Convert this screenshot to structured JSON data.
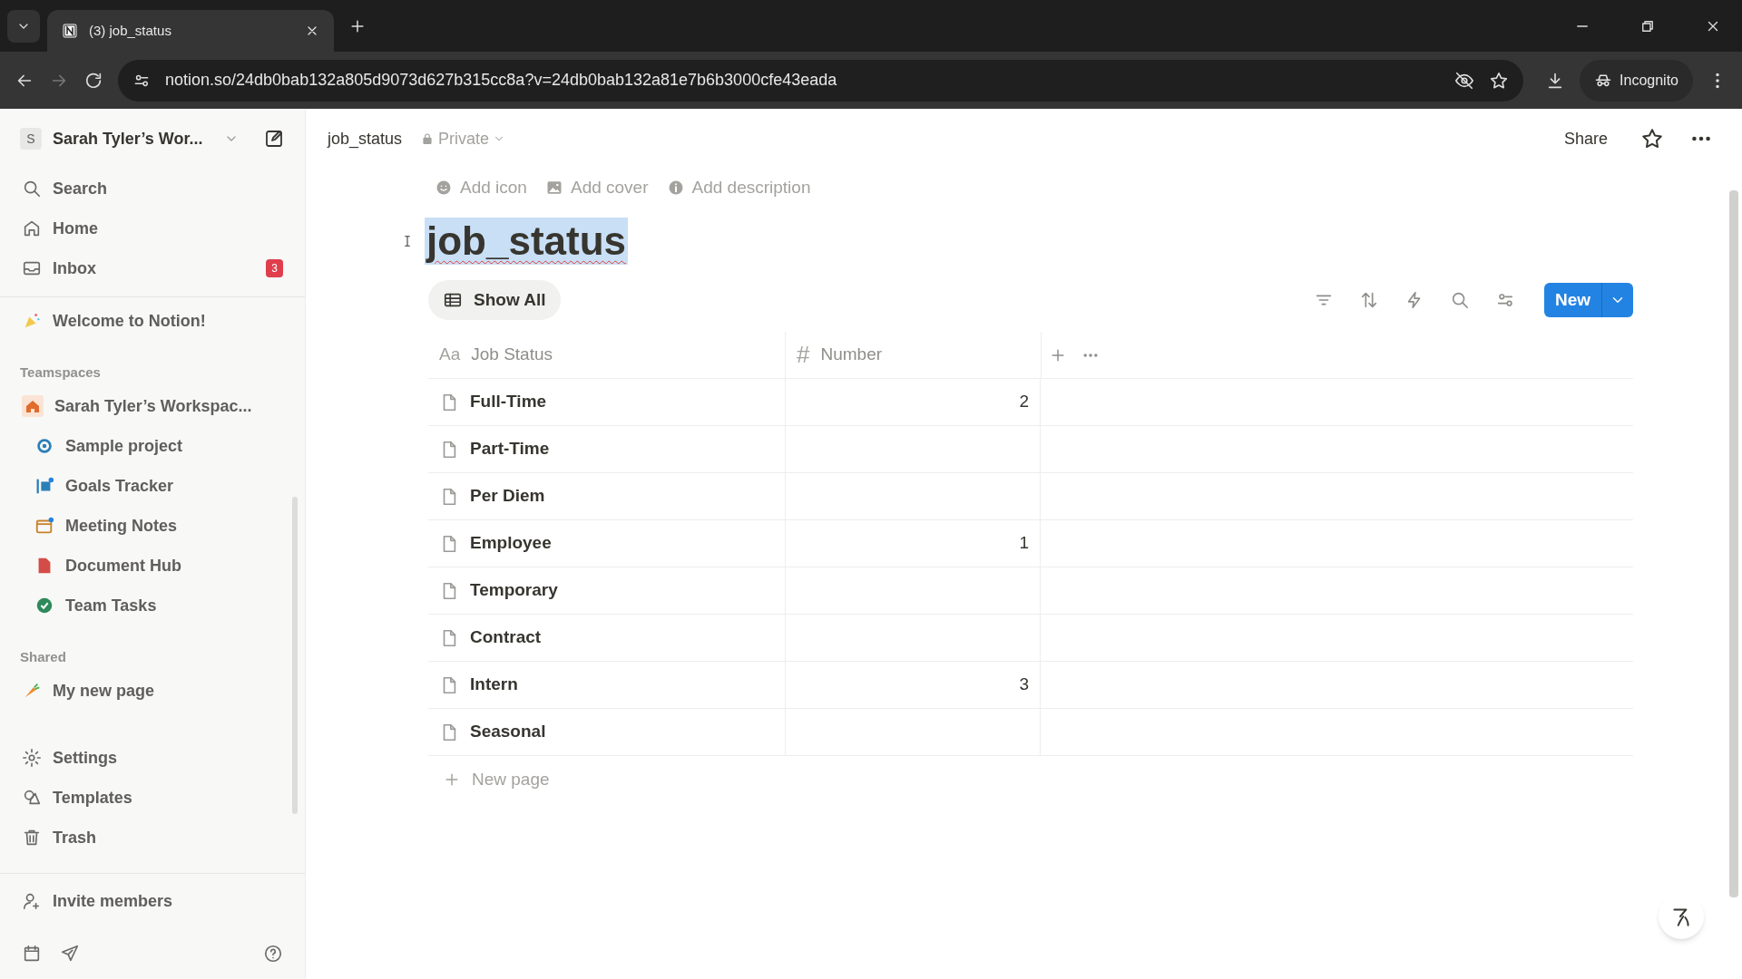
{
  "browser": {
    "tab_title": "(3) job_status",
    "url": "notion.so/24db0bab132a805d9073d627b315cc8a?v=24db0bab132a81e7b6b3000cfe43eada",
    "profile": "Incognito"
  },
  "sidebar": {
    "workspace": {
      "avatar": "S",
      "name": "Sarah Tyler’s Wor..."
    },
    "nav": [
      {
        "label": "Search"
      },
      {
        "label": "Home"
      },
      {
        "label": "Inbox",
        "badge": "3"
      }
    ],
    "private": [
      {
        "label": "Welcome to Notion!"
      }
    ],
    "teamspaces": {
      "heading": "Teamspaces",
      "workspace": "Sarah Tyler’s Workspac...",
      "items": [
        {
          "label": "Sample project"
        },
        {
          "label": "Goals Tracker"
        },
        {
          "label": "Meeting Notes"
        },
        {
          "label": "Document Hub"
        },
        {
          "label": "Team Tasks"
        }
      ]
    },
    "shared": {
      "heading": "Shared",
      "items": [
        {
          "label": "My new page"
        }
      ]
    },
    "footer": [
      {
        "label": "Settings"
      },
      {
        "label": "Templates"
      },
      {
        "label": "Trash"
      }
    ],
    "invite": "Invite members"
  },
  "topbar": {
    "breadcrumb": "job_status",
    "privacy": "Private",
    "share": "Share"
  },
  "page": {
    "actions": [
      "Add icon",
      "Add cover",
      "Add description"
    ],
    "title": "job_status",
    "title_selected": true,
    "view": "Show All",
    "new_button": "New",
    "columns": [
      {
        "glyph": "Aa",
        "label": "Job Status"
      },
      {
        "glyph": "#",
        "label": "Number"
      }
    ],
    "rows": [
      {
        "name": "Full-Time",
        "number": "2"
      },
      {
        "name": "Part-Time"
      },
      {
        "name": "Per Diem"
      },
      {
        "name": "Employee",
        "number": "1"
      },
      {
        "name": "Temporary"
      },
      {
        "name": "Contract"
      },
      {
        "name": "Intern",
        "number": "3"
      },
      {
        "name": "Seasonal"
      }
    ],
    "new_page": "New page"
  }
}
